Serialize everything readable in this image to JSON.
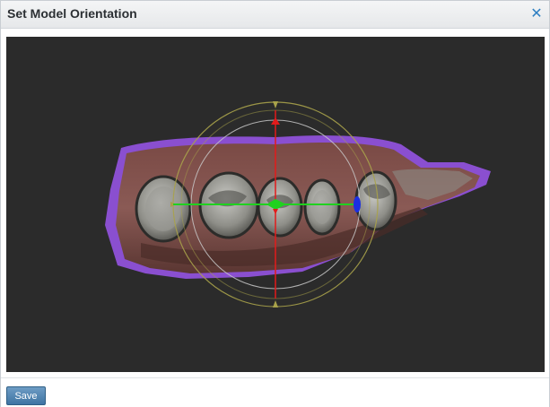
{
  "dialog": {
    "title": "Set Model Orientation",
    "close_icon": "close-x-icon",
    "accent_color": "#2e7fc2"
  },
  "viewport": {
    "background_color": "#2b2b2b",
    "model": "dental-scan",
    "gizmo": {
      "x_axis_color": "#1fd11f",
      "y_axis_color": "#e21b1b",
      "z_axis_color": "#1b2fe2",
      "ring_color": "#a8a24a"
    }
  },
  "footer": {
    "save_label": "Save"
  }
}
